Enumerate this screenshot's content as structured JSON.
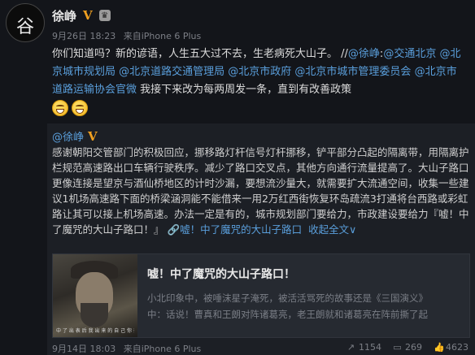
{
  "post": {
    "author": "徐峥",
    "avatar_text": "谷",
    "meta": {
      "date": "9月26日 18:23",
      "source_prefix": "来自",
      "source": "iPhone 6 Plus"
    },
    "text": {
      "lead": "你们知道吗？新的谚语，人生五大过不去，生老病死大山子。 //",
      "mention_self": "@徐峥",
      "sep": ":",
      "mention_1": "@交通北京",
      "mention_2": " @北京城市规划局",
      "mention_3": " @北京道路交通管理局",
      "mention_4": " @北京市政府",
      "mention_5": " @北京市城市管理委员会",
      "mention_6": " @北京市道路运输协会官微",
      "tail": " 我接下来改为每两周发一条，直到有改善政策"
    }
  },
  "repost": {
    "author": "@徐峥",
    "text": "感谢朝阳交管部门的积极回应，挪移路灯杆信号灯杆挪移，铲平部分凸起的隔离带，用隔离护栏规范高速路出口车辆行驶秩序。减少了路口交叉点，其他方向通行流量提高了。大山子路口更像连接是望京与酒仙桥地区的计时沙漏，要想流沙量大，就需要扩大流通空间，收集一些建议1机场高速路下面的桥梁涵洞能不能借来一用2万红西街恢复环岛疏流3打通将台西路或彩虹路让其可以接上机场高速。办法一定是有的，城市规划部门要给力，市政建设要给力『嘘！中了魔咒的大山子路口！』",
    "link_text": "嘘！中了魔咒的大山子路口",
    "expand_text": "收起全文",
    "expand_arrow": "∨",
    "card": {
      "title": "嘘！中了魔咒的大山子路口！",
      "desc_line1": "小北印象中，被唾沫星子淹死，被活活骂死的故事还是《三国演义》",
      "desc_line2": "中：话说！曹真和王朗对阵诸葛亮，老王朗就和诸葛亮在阵前撕了起",
      "thumb_subtitle": "中 了 出 表 后 我 出 来 的 自 己 你 去 吧"
    },
    "footer": {
      "date": "9月14日 18:03",
      "source_prefix": "来自",
      "source": "iPhone 6 Plus",
      "shares": "1154",
      "comments": "269",
      "likes": "4623"
    }
  },
  "icons": {
    "share": "share-icon",
    "comment": "comment-icon",
    "like": "thumbs-up-icon",
    "vip": "verified-v-icon",
    "crown": "crown-icon",
    "link": "link-icon"
  },
  "colors": {
    "link": "#5a9fdc",
    "vip": "#f0a020",
    "bg": "#13151a",
    "repost_bg": "#1c1f25"
  }
}
